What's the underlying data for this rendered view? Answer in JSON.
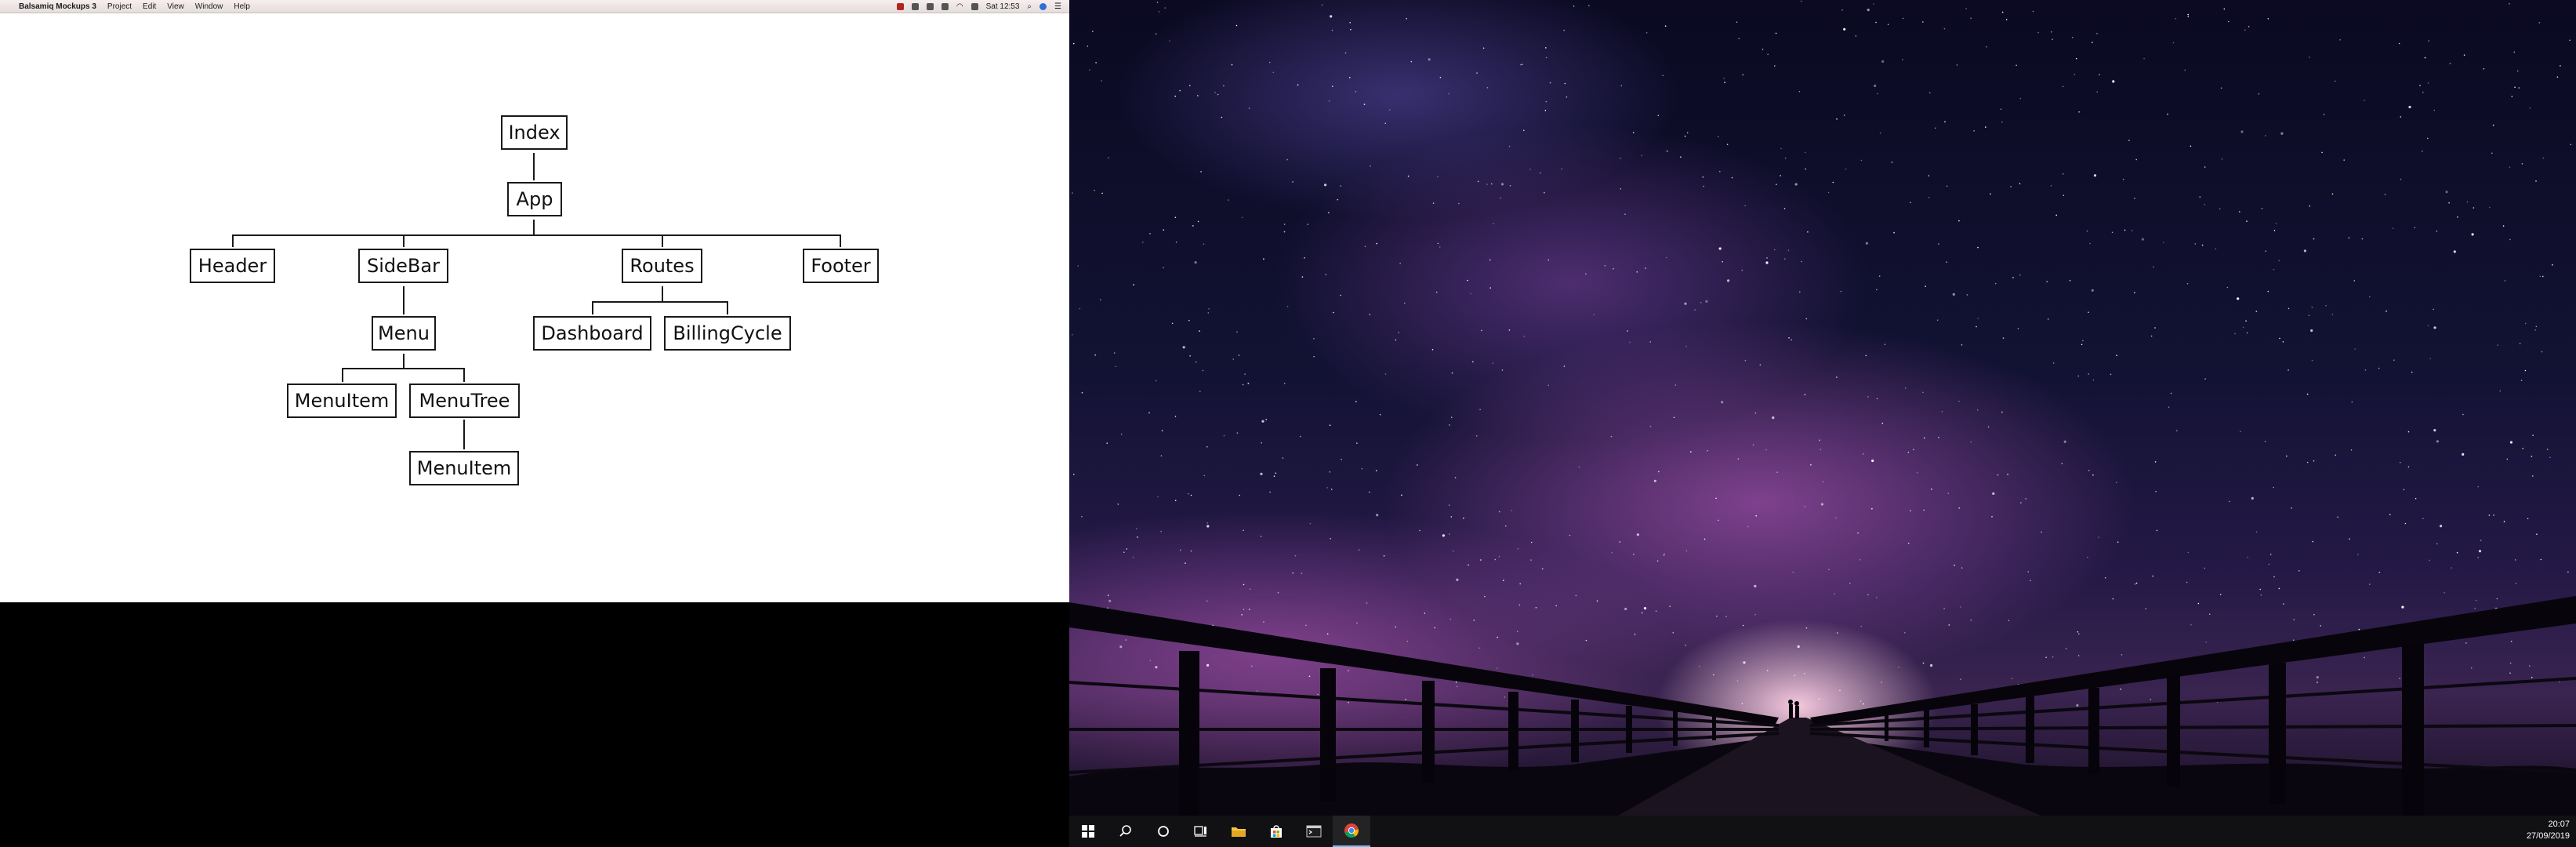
{
  "mac": {
    "menubar": {
      "apple_glyph": "",
      "app_name": "Balsamiq Mockups 3",
      "menus": [
        "Project",
        "Edit",
        "View",
        "Window",
        "Help"
      ],
      "clock": "Sat 12:53"
    },
    "diagram": {
      "nodes": {
        "index": "Index",
        "app": "App",
        "header": "Header",
        "sidebar": "SideBar",
        "routes": "Routes",
        "footer": "Footer",
        "menu": "Menu",
        "dashboard": "Dashboard",
        "billing_cycle": "BillingCycle",
        "menu_item": "MenuItem",
        "menu_tree": "MenuTree",
        "menu_item_child": "MenuItem"
      }
    }
  },
  "windows": {
    "taskbar": {
      "icons": [
        "windows-start-icon",
        "search-icon",
        "cortana-icon",
        "task-view-icon",
        "file-explorer-icon",
        "store-icon",
        "terminal-icon",
        "chrome-icon"
      ],
      "time": "20:07",
      "date": "27/09/2019"
    }
  }
}
